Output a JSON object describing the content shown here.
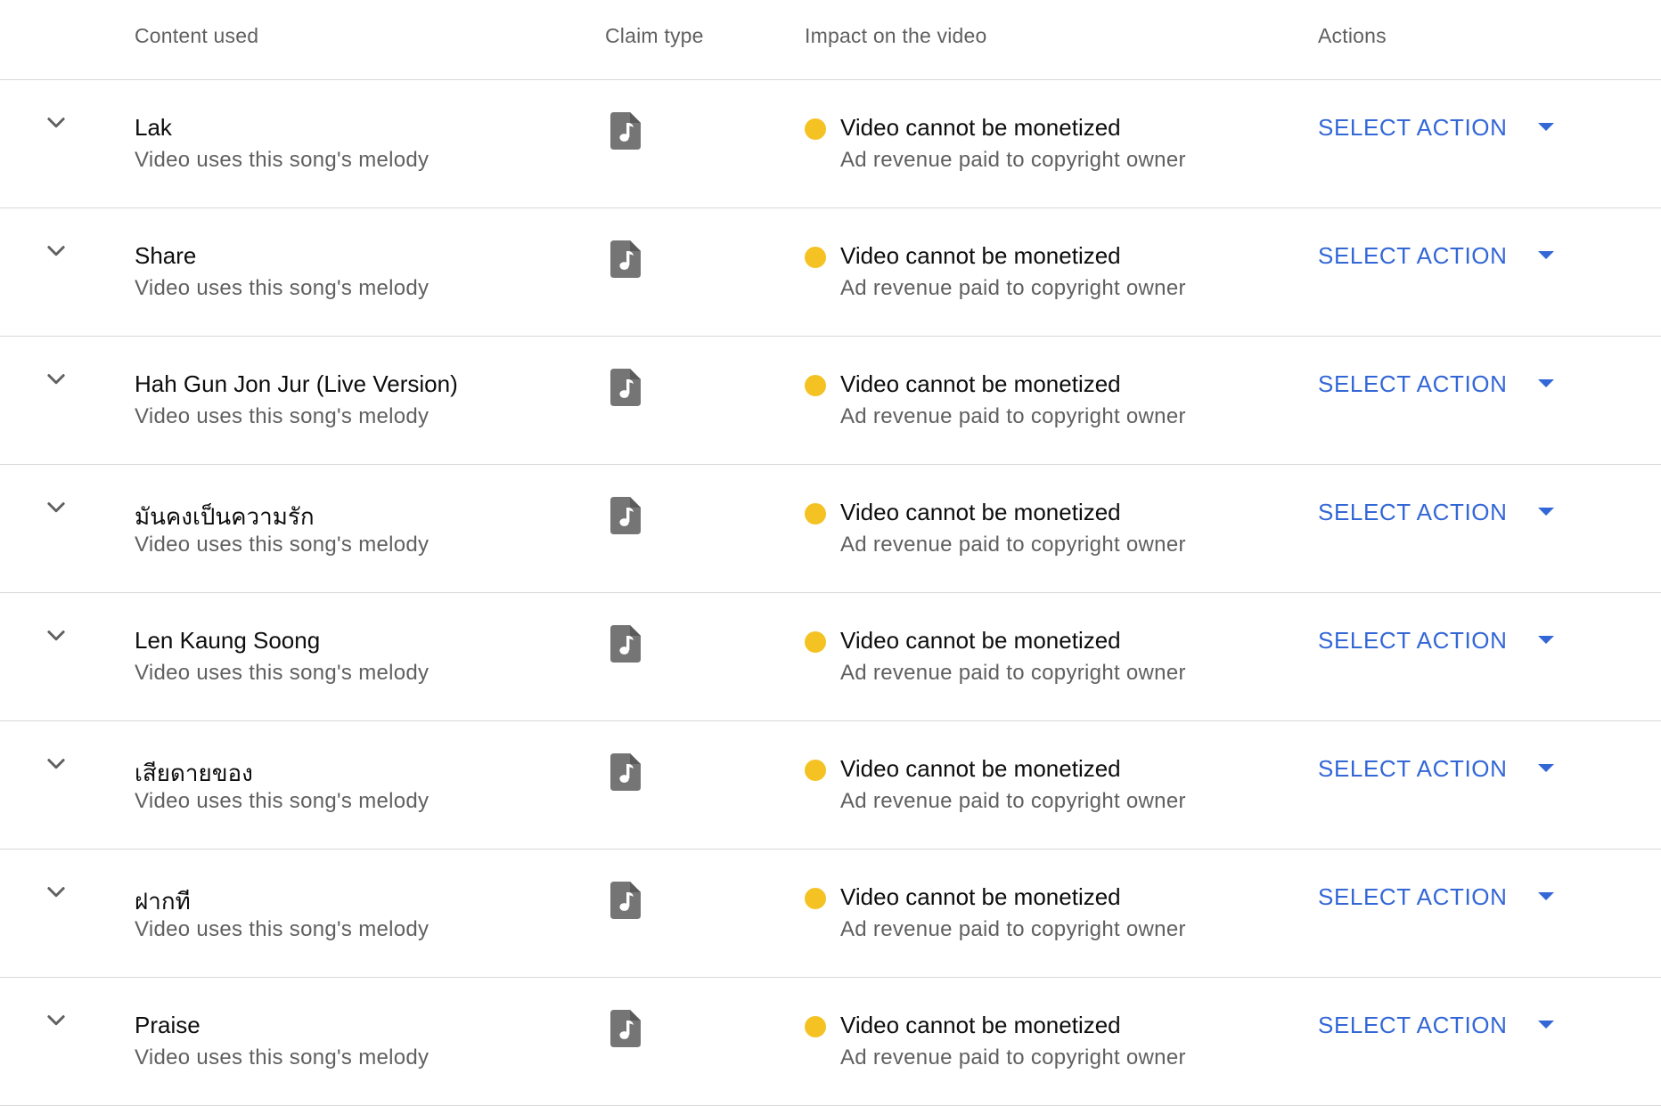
{
  "header": {
    "content_used": "Content used",
    "claim_type": "Claim type",
    "impact": "Impact on the video",
    "actions": "Actions"
  },
  "colors": {
    "accent_blue": "#3367d6",
    "status_yellow": "#f4c223",
    "icon_gray": "#757575"
  },
  "icons": {
    "expand": "chevron-down-icon",
    "claim": "music-file-icon",
    "dropdown": "caret-down-icon"
  },
  "rows": [
    {
      "title": "Lak",
      "subtitle": "Video uses this song's melody",
      "impact_title": "Video cannot be monetized",
      "impact_sub": "Ad revenue paid to copyright owner",
      "action": "SELECT ACTION"
    },
    {
      "title": "Share",
      "subtitle": "Video uses this song's melody",
      "impact_title": "Video cannot be monetized",
      "impact_sub": "Ad revenue paid to copyright owner",
      "action": "SELECT ACTION"
    },
    {
      "title": "Hah Gun Jon Jur (Live Version)",
      "subtitle": "Video uses this song's melody",
      "impact_title": "Video cannot be monetized",
      "impact_sub": "Ad revenue paid to copyright owner",
      "action": "SELECT ACTION"
    },
    {
      "title": "มันคงเป็นความรัก",
      "subtitle": "Video uses this song's melody",
      "impact_title": "Video cannot be monetized",
      "impact_sub": "Ad revenue paid to copyright owner",
      "action": "SELECT ACTION"
    },
    {
      "title": "Len Kaung Soong",
      "subtitle": "Video uses this song's melody",
      "impact_title": "Video cannot be monetized",
      "impact_sub": "Ad revenue paid to copyright owner",
      "action": "SELECT ACTION"
    },
    {
      "title": "เสียดายของ",
      "subtitle": "Video uses this song's melody",
      "impact_title": "Video cannot be monetized",
      "impact_sub": "Ad revenue paid to copyright owner",
      "action": "SELECT ACTION"
    },
    {
      "title": "ฝากที",
      "subtitle": "Video uses this song's melody",
      "impact_title": "Video cannot be monetized",
      "impact_sub": "Ad revenue paid to copyright owner",
      "action": "SELECT ACTION"
    },
    {
      "title": "Praise",
      "subtitle": "Video uses this song's melody",
      "impact_title": "Video cannot be monetized",
      "impact_sub": "Ad revenue paid to copyright owner",
      "action": "SELECT ACTION"
    }
  ]
}
